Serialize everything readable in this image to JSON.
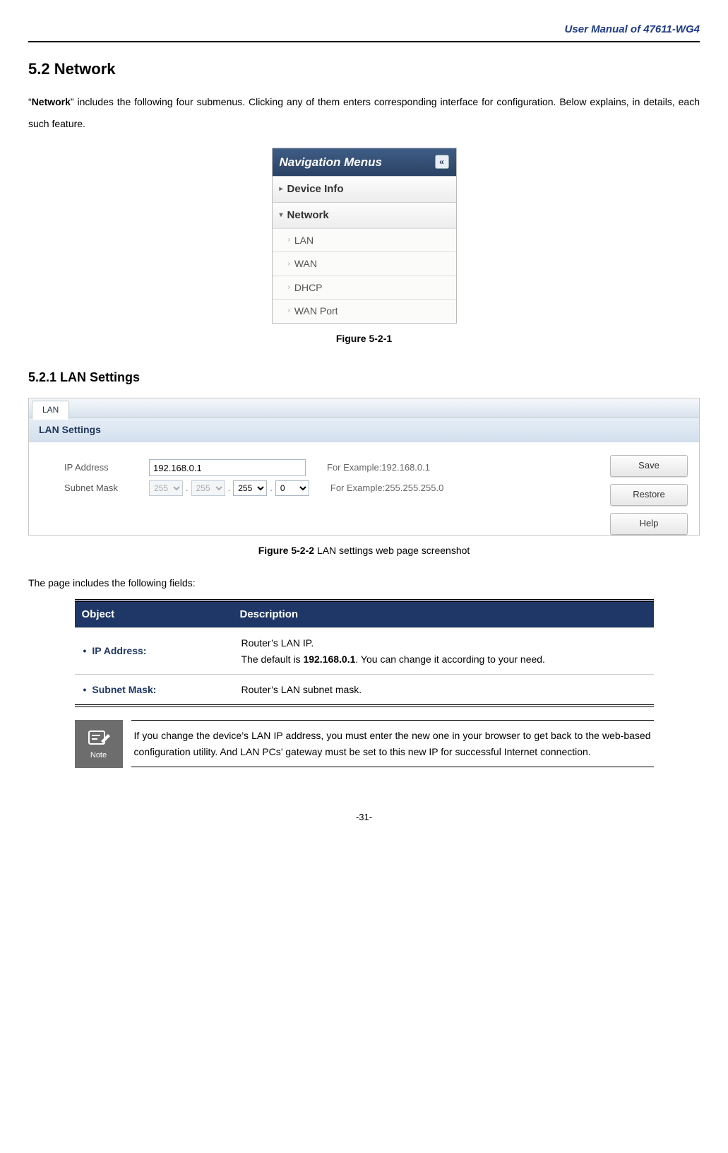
{
  "header": {
    "manual_title": "User Manual of 47611-WG4"
  },
  "section": {
    "num_title": "5.2  Network",
    "intro_pre": "“",
    "intro_bold": "Network",
    "intro_post": "” includes the following four submenus. Clicking any of them enters corresponding interface for configuration. Below explains, in details, each such feature."
  },
  "nav": {
    "title": "Navigation Menus",
    "device_info": "Device Info",
    "network": "Network",
    "items": [
      {
        "label": "LAN"
      },
      {
        "label": "WAN"
      },
      {
        "label": "DHCP"
      },
      {
        "label": "WAN Port"
      }
    ]
  },
  "fig1": {
    "caption": "Figure 5-2-1"
  },
  "subsection": {
    "title": "5.2.1  LAN Settings"
  },
  "lan": {
    "tab": "LAN",
    "header": "LAN Settings",
    "ip_label": "IP Address",
    "ip_value": "192.168.0.1",
    "ip_hint": "For Example:192.168.0.1",
    "mask_label": "Subnet Mask",
    "mask_oct1": "255",
    "mask_oct2": "255",
    "mask_oct3": "255",
    "mask_oct4": "0",
    "mask_hint": "For Example:255.255.255.0",
    "buttons": {
      "save": "Save",
      "restore": "Restore",
      "help": "Help"
    }
  },
  "fig2": {
    "caption_bold": "Figure 5-2-2",
    "caption_rest": " LAN settings web page screenshot"
  },
  "fields_intro": "The page includes the following fields:",
  "table": {
    "col_object": "Object",
    "col_desc": "Description",
    "rows": [
      {
        "obj": "IP Address:",
        "desc_line1": "Router’s LAN IP.",
        "desc_line2_pre": "The default is ",
        "desc_line2_bold": "192.168.0.1",
        "desc_line2_post": ". You can change it according to your need."
      },
      {
        "obj": "Subnet Mask:",
        "desc_full": "Router’s LAN subnet mask."
      }
    ]
  },
  "note": {
    "label": "Note",
    "text": "If you change the device’s LAN IP address, you must enter the new one in your browser to get back to the web-based configuration utility. And LAN PCs’ gateway must be set to this new IP for successful Internet connection."
  },
  "page_number": "-31-"
}
